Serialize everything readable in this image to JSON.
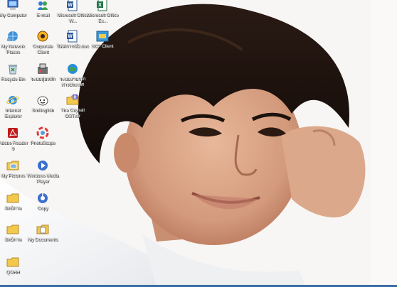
{
  "desktop": {
    "icons": [
      {
        "label": "My Computer",
        "icon": "my-computer-icon"
      },
      {
        "label": "E-mail",
        "icon": "email-icon"
      },
      {
        "label": "Microsoft Office W...",
        "icon": "word-icon"
      },
      {
        "label": "Microsoft Office Ex...",
        "icon": "excel-icon"
      },
      {
        "label": "My Network Places",
        "icon": "network-places-icon"
      },
      {
        "label": "Corporate Client",
        "icon": "corporate-client-icon"
      },
      {
        "label": "นิทัศการณ์2.doc",
        "icon": "word-doc-icon"
      },
      {
        "label": "SCP Client",
        "icon": "scp-client-icon"
      },
      {
        "label": "Recycle Bin",
        "icon": "recycle-bin-icon"
      },
      {
        "label": "ระบบสุ่มหลัก",
        "icon": "program-icon"
      },
      {
        "label": "ระบบงานจาก ต่างประเทศ",
        "icon": "globe-program-icon"
      },
      {
        "label": "Internet Explorer",
        "icon": "internet-explorer-icon"
      },
      {
        "label": "Smilingfish",
        "icon": "smilingfish-icon"
      },
      {
        "label": "The Cityhall OST.rar",
        "icon": "rar-archive-icon"
      },
      {
        "label": "Adobe Reader 9",
        "icon": "adobe-reader-icon"
      },
      {
        "label": "PhotoScape",
        "icon": "photoscape-icon"
      },
      {
        "label": "My Pictures",
        "icon": "my-pictures-icon"
      },
      {
        "label": "Windows Media Player",
        "icon": "media-player-icon"
      },
      {
        "label": "อัลบ์ภาพ",
        "icon": "folder-icon"
      },
      {
        "label": "Copy",
        "icon": "copy-shortcut-icon"
      },
      {
        "label": "อัลบ์ภาพ",
        "icon": "folder-icon"
      },
      {
        "label": "My Documents",
        "icon": "my-documents-icon"
      },
      {
        "label": "QOHH",
        "icon": "folder-icon"
      }
    ]
  },
  "colors": {
    "folder": "#f2c94c",
    "taskbar": "#3a6ea5"
  }
}
